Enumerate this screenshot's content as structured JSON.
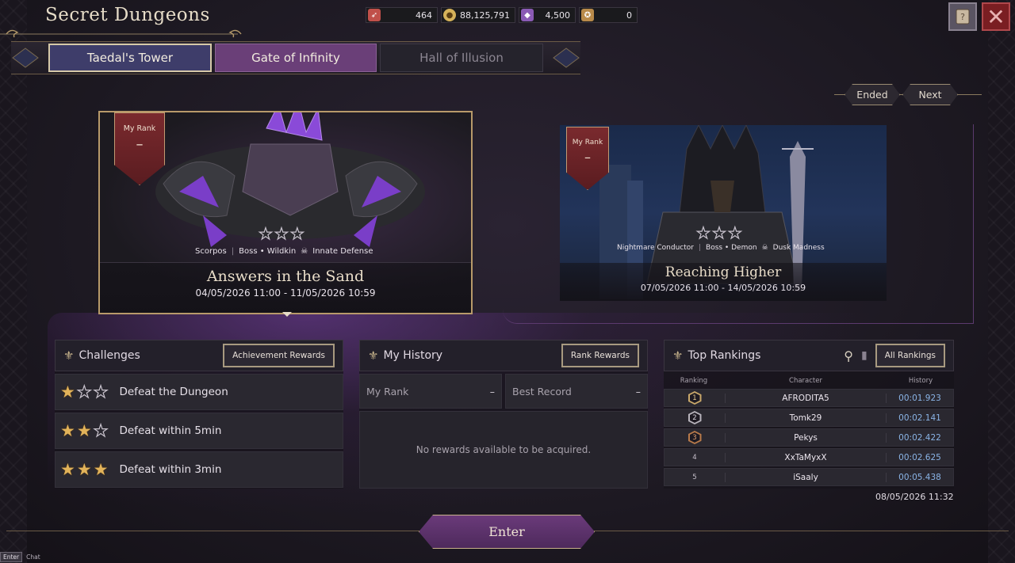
{
  "header": {
    "title": "Secret Dungeons",
    "currencies": [
      {
        "icon": "ticket-icon",
        "value": "464",
        "color": "#c0504a"
      },
      {
        "icon": "silver-coin-icon",
        "value": "88,125,791",
        "color": "#d6b25a"
      },
      {
        "icon": "purple-crystal-icon",
        "value": "4,500",
        "color": "#8a5ab4"
      },
      {
        "icon": "medal-icon",
        "value": "0",
        "color": "#b88a4a"
      }
    ]
  },
  "tabs": [
    {
      "label": "Taedal's Tower",
      "state": "selected"
    },
    {
      "label": "Gate of Infinity",
      "state": "active"
    },
    {
      "label": "Hall of Illusion",
      "state": "inactive"
    }
  ],
  "nav": {
    "ended_label": "Ended",
    "next_label": "Next"
  },
  "cards": [
    {
      "rank_label": "My Rank",
      "rank_value": "–",
      "boss_name": "Scorpos",
      "boss_type": "Boss • Wildkin",
      "trait": "Innate Defense",
      "title": "Answers in the Sand",
      "dates": "04/05/2026 11:00 - 11/05/2026 10:59"
    },
    {
      "rank_label": "My Rank",
      "rank_value": "–",
      "boss_name": "Nightmare Conductor",
      "boss_type": "Boss • Demon",
      "trait": "Dusk Madness",
      "title": "Reaching Higher",
      "dates": "07/05/2026 11:00 - 14/05/2026 10:59"
    }
  ],
  "challenges": {
    "title": "Challenges",
    "button": "Achievement Rewards",
    "items": [
      {
        "stars": 1,
        "label": "Defeat the Dungeon"
      },
      {
        "stars": 2,
        "label": "Defeat within 5min"
      },
      {
        "stars": 3,
        "label": "Defeat within 3min"
      }
    ]
  },
  "history": {
    "title": "My History",
    "button": "Rank Rewards",
    "my_rank_label": "My Rank",
    "my_rank_value": "–",
    "best_record_label": "Best Record",
    "best_record_value": "–",
    "empty_message": "No rewards available to be acquired."
  },
  "rankings": {
    "title": "Top Rankings",
    "button": "All Rankings",
    "columns": {
      "ranking": "Ranking",
      "character": "Character",
      "history": "History"
    },
    "rows": [
      {
        "rank": "1",
        "character": "AFRODITA5",
        "time": "00:01.923"
      },
      {
        "rank": "2",
        "character": "Tomk29",
        "time": "00:02.141"
      },
      {
        "rank": "3",
        "character": "Pekys",
        "time": "00:02.422"
      },
      {
        "rank": "4",
        "character": "XxTaMyxX",
        "time": "00:02.625"
      },
      {
        "rank": "5",
        "character": "iSaaly",
        "time": "00:05.438"
      }
    ],
    "timestamp": "08/05/2026 11:32"
  },
  "enter_label": "Enter",
  "hint": {
    "key": "Enter",
    "label": "Chat"
  }
}
